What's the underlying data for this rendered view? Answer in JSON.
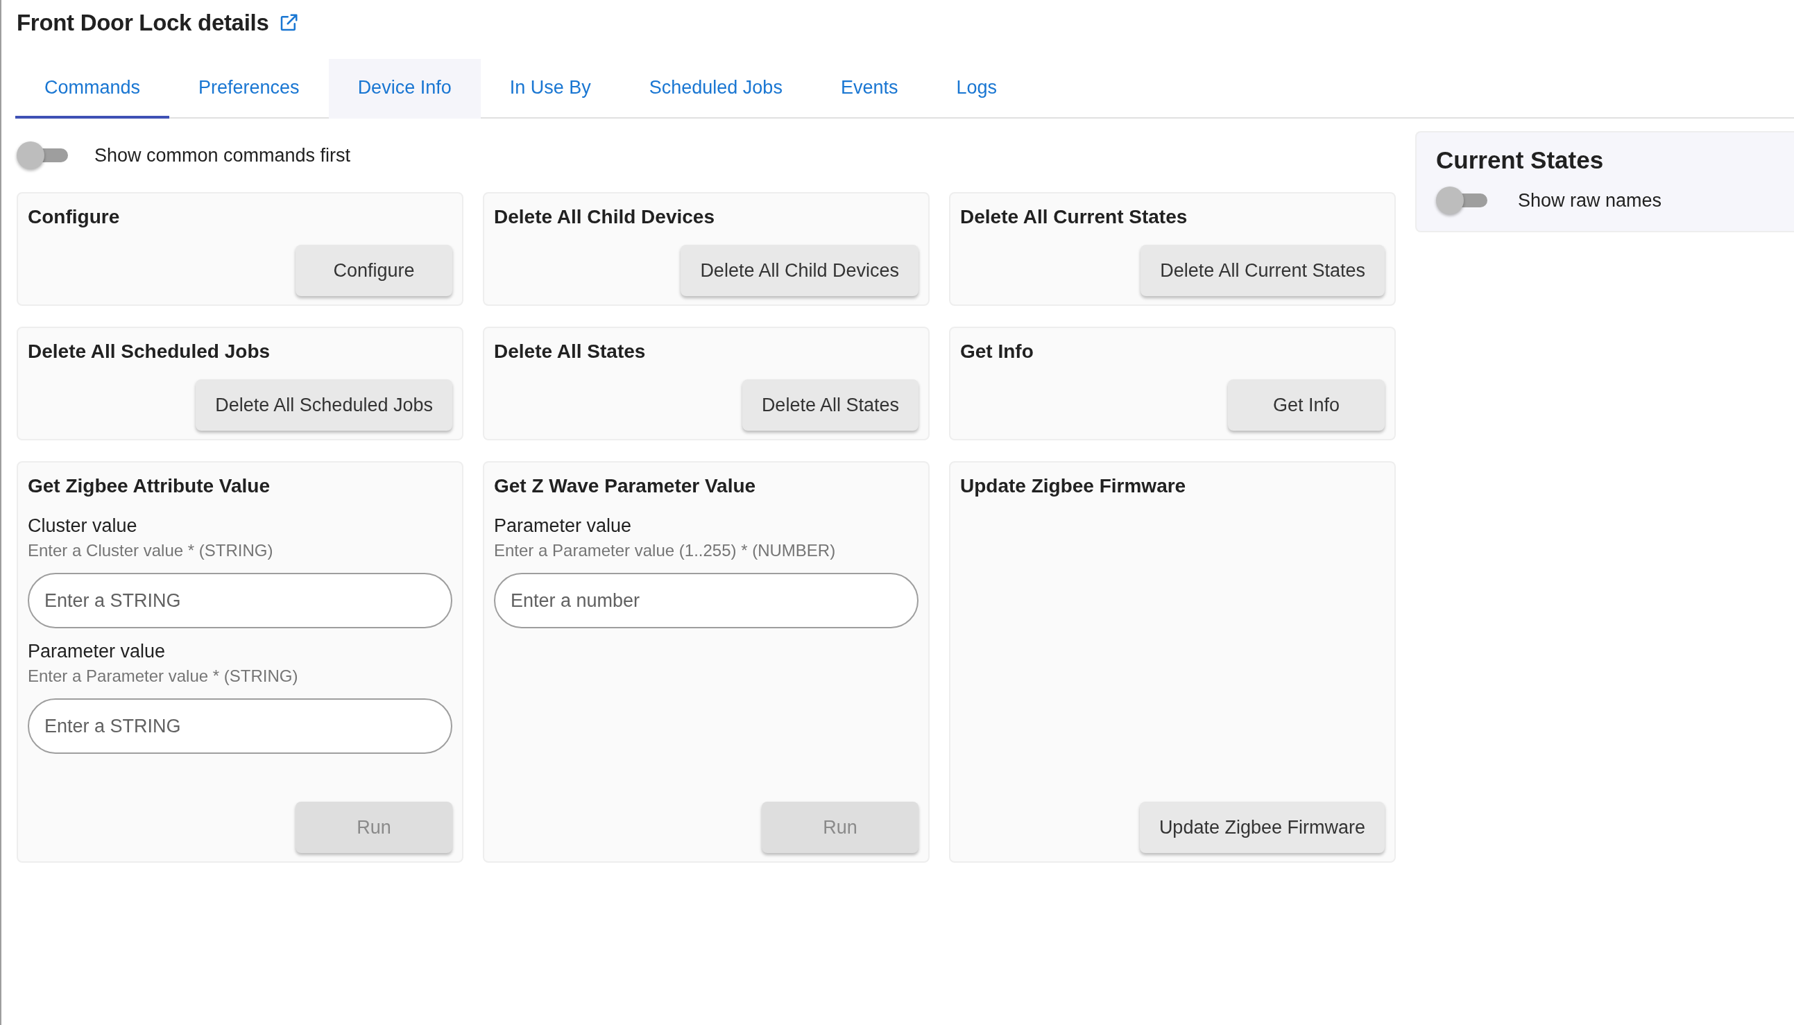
{
  "title": "Front Door Lock details",
  "tabs": [
    {
      "label": "Commands",
      "selected": true,
      "hovered": false
    },
    {
      "label": "Preferences",
      "selected": false,
      "hovered": false
    },
    {
      "label": "Device Info",
      "selected": false,
      "hovered": true
    },
    {
      "label": "In Use By",
      "selected": false,
      "hovered": false
    },
    {
      "label": "Scheduled Jobs",
      "selected": false,
      "hovered": false
    },
    {
      "label": "Events",
      "selected": false,
      "hovered": false
    },
    {
      "label": "Logs",
      "selected": false,
      "hovered": false
    }
  ],
  "common_toggle": {
    "label": "Show common commands first",
    "on": false
  },
  "commands": [
    {
      "title": "Configure",
      "button": "Configure",
      "disabled": false
    },
    {
      "title": "Delete All Child Devices",
      "button": "Delete All Child Devices",
      "disabled": false
    },
    {
      "title": "Delete All Current States",
      "button": "Delete All Current States",
      "disabled": false
    },
    {
      "title": "Delete All Scheduled Jobs",
      "button": "Delete All Scheduled Jobs",
      "disabled": false
    },
    {
      "title": "Delete All States",
      "button": "Delete All States",
      "disabled": false
    },
    {
      "title": "Get Info",
      "button": "Get Info",
      "disabled": false
    },
    {
      "title": "Get Zigbee Attribute Value",
      "button": "Run",
      "disabled": true,
      "fields": [
        {
          "label": "Cluster value",
          "hint": "Enter a Cluster value * (STRING)",
          "placeholder": "Enter a STRING"
        },
        {
          "label": "Parameter value",
          "hint": "Enter a Parameter value * (STRING)",
          "placeholder": "Enter a STRING"
        }
      ]
    },
    {
      "title": "Get Z Wave Parameter Value",
      "button": "Run",
      "disabled": true,
      "fields": [
        {
          "label": "Parameter value",
          "hint": "Enter a Parameter value (1..255) * (NUMBER)",
          "placeholder": "Enter a number"
        }
      ]
    },
    {
      "title": "Update Zigbee Firmware",
      "button": "Update Zigbee Firmware",
      "disabled": false
    }
  ],
  "current_states": {
    "title": "Current States",
    "toggle_label": "Show raw names",
    "raw_names": false
  }
}
